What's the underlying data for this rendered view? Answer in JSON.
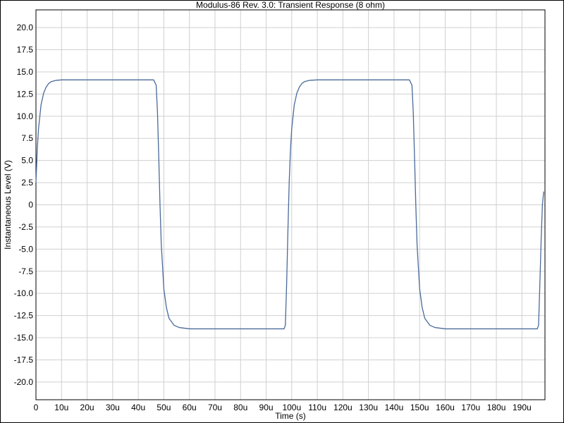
{
  "chart_data": {
    "type": "line",
    "title": "Modulus-86 Rev. 3.0: Transient Response (8 ohm)",
    "xlabel": "Time (s)",
    "ylabel": "Instantaneous Level (V)",
    "xlim": [
      0,
      199
    ],
    "ylim": [
      -22,
      22
    ],
    "grid": true,
    "x_ticks": [
      {
        "value": 0,
        "label": "0"
      },
      {
        "value": 10,
        "label": "10u"
      },
      {
        "value": 20,
        "label": "20u"
      },
      {
        "value": 30,
        "label": "30u"
      },
      {
        "value": 40,
        "label": "40u"
      },
      {
        "value": 50,
        "label": "50u"
      },
      {
        "value": 60,
        "label": "60u"
      },
      {
        "value": 70,
        "label": "70u"
      },
      {
        "value": 80,
        "label": "80u"
      },
      {
        "value": 90,
        "label": "90u"
      },
      {
        "value": 100,
        "label": "100u"
      },
      {
        "value": 110,
        "label": "110u"
      },
      {
        "value": 120,
        "label": "120u"
      },
      {
        "value": 130,
        "label": "130u"
      },
      {
        "value": 140,
        "label": "140u"
      },
      {
        "value": 150,
        "label": "150u"
      },
      {
        "value": 160,
        "label": "160u"
      },
      {
        "value": 170,
        "label": "170u"
      },
      {
        "value": 180,
        "label": "180u"
      },
      {
        "value": 190,
        "label": "190u"
      }
    ],
    "y_ticks": [
      {
        "value": 20,
        "label": "20.0"
      },
      {
        "value": 17.5,
        "label": "17.5"
      },
      {
        "value": 15,
        "label": "15.0"
      },
      {
        "value": 12.5,
        "label": "12.5"
      },
      {
        "value": 10,
        "label": "10.0"
      },
      {
        "value": 7.5,
        "label": "7.5"
      },
      {
        "value": 5,
        "label": "5.0"
      },
      {
        "value": 2.5,
        "label": "2.5"
      },
      {
        "value": 0,
        "label": "0"
      },
      {
        "value": -2.5,
        "label": "-2.5"
      },
      {
        "value": -5,
        "label": "-5.0"
      },
      {
        "value": -7.5,
        "label": "-7.5"
      },
      {
        "value": -10,
        "label": "-10.0"
      },
      {
        "value": -12.5,
        "label": "-12.5"
      },
      {
        "value": -15,
        "label": "-15.0"
      },
      {
        "value": -17.5,
        "label": "-17.5"
      },
      {
        "value": -20,
        "label": "-20.0"
      }
    ],
    "series": [
      {
        "color": "#4a6a9a",
        "points": [
          [
            0,
            2.5
          ],
          [
            0.5,
            6.2
          ],
          [
            1,
            8.6
          ],
          [
            2,
            11.3
          ],
          [
            3,
            12.6
          ],
          [
            4,
            13.3
          ],
          [
            5,
            13.7
          ],
          [
            6,
            13.9
          ],
          [
            8,
            14.05
          ],
          [
            10,
            14.1
          ],
          [
            20,
            14.1
          ],
          [
            30,
            14.1
          ],
          [
            40,
            14.1
          ],
          [
            46,
            14.1
          ],
          [
            47,
            13.5
          ],
          [
            47.5,
            10.5
          ],
          [
            48,
            5.5
          ],
          [
            48.5,
            0
          ],
          [
            49,
            -4.5
          ],
          [
            50,
            -9.5
          ],
          [
            51,
            -11.6
          ],
          [
            52,
            -12.8
          ],
          [
            54,
            -13.6
          ],
          [
            56,
            -13.85
          ],
          [
            60,
            -14.0
          ],
          [
            70,
            -14.0
          ],
          [
            80,
            -14.0
          ],
          [
            90,
            -14.0
          ],
          [
            97,
            -14.0
          ],
          [
            97.5,
            -13.6
          ],
          [
            98,
            -9.0
          ],
          [
            98.5,
            -3.0
          ],
          [
            99,
            2.5
          ],
          [
            99.5,
            6.2
          ],
          [
            100,
            8.6
          ],
          [
            101,
            11.3
          ],
          [
            102,
            12.6
          ],
          [
            103,
            13.3
          ],
          [
            104,
            13.7
          ],
          [
            105,
            13.9
          ],
          [
            107,
            14.05
          ],
          [
            110,
            14.1
          ],
          [
            120,
            14.1
          ],
          [
            130,
            14.1
          ],
          [
            140,
            14.1
          ],
          [
            146,
            14.1
          ],
          [
            147,
            13.5
          ],
          [
            147.5,
            10.5
          ],
          [
            148,
            5.5
          ],
          [
            148.5,
            0
          ],
          [
            149,
            -4.5
          ],
          [
            150,
            -9.5
          ],
          [
            151,
            -11.6
          ],
          [
            152,
            -12.8
          ],
          [
            154,
            -13.6
          ],
          [
            156,
            -13.85
          ],
          [
            160,
            -14.0
          ],
          [
            170,
            -14.0
          ],
          [
            180,
            -14.0
          ],
          [
            190,
            -14.0
          ],
          [
            196,
            -14.0
          ],
          [
            196.5,
            -13.6
          ],
          [
            197,
            -9.0
          ],
          [
            197.5,
            -4.0
          ],
          [
            198,
            0
          ],
          [
            198.5,
            1.5
          ]
        ]
      }
    ]
  }
}
